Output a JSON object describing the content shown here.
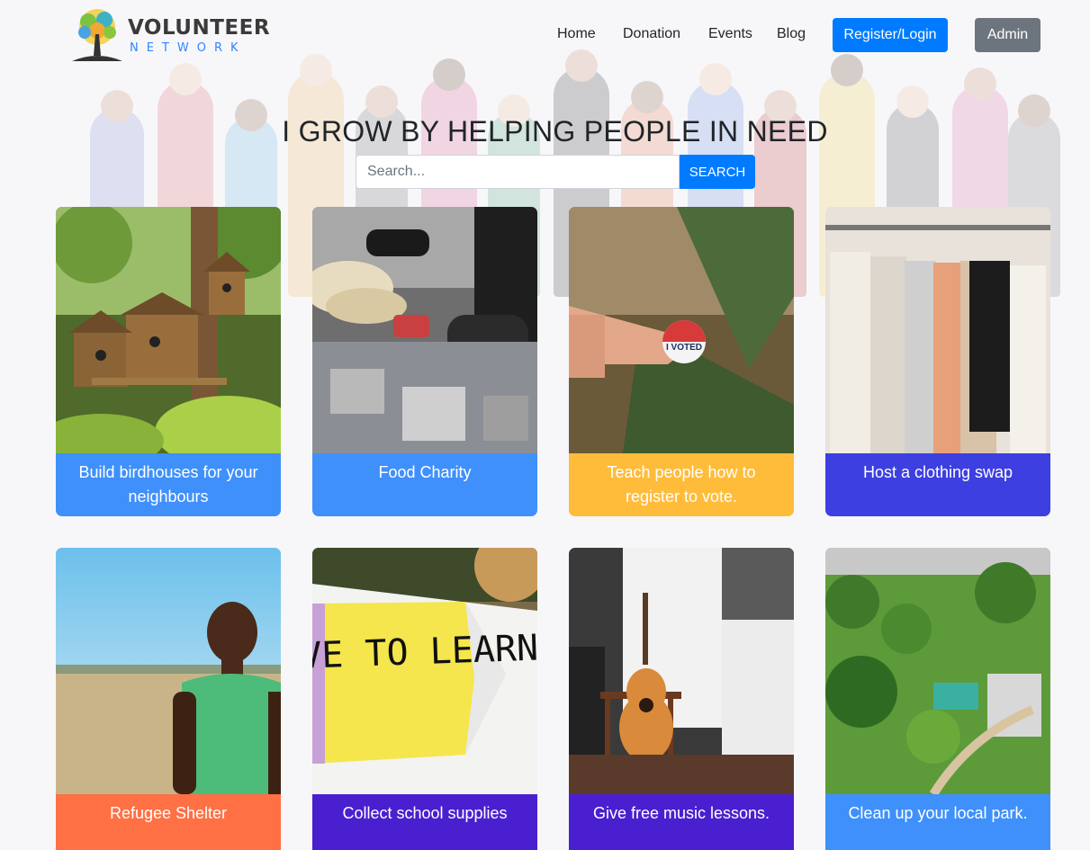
{
  "brand": {
    "title": "VOLUNTEER",
    "subtitle": "NETWORK"
  },
  "nav": {
    "items": [
      "Home",
      "Donation",
      "Events",
      "Blog"
    ],
    "register_label": "Register/Login",
    "admin_label": "Admin"
  },
  "hero": {
    "title": "I GROW BY HELPING PEOPLE IN NEED"
  },
  "search": {
    "placeholder": "Search...",
    "button_label": "SEARCH"
  },
  "colors": {
    "primary": "#007bff",
    "secondary": "#6c757d",
    "blue": "#3f90fb",
    "yellow": "#ffbc3a",
    "indigo": "#3d3fe0",
    "orange": "#ff7044",
    "purple": "#4a1fcf"
  },
  "events": [
    {
      "title": "Build birdhouses for your neighbours",
      "image": "birdhouses-photo",
      "color": "#3f90fb"
    },
    {
      "title": "Food Charity",
      "image": "food-charity-photo",
      "color": "#3f90fb"
    },
    {
      "title": "Teach people how to register to vote.",
      "image": "i-voted-sticker-photo",
      "color": "#ffbc3a"
    },
    {
      "title": "Host a clothing swap",
      "image": "clothing-rack-photo",
      "color": "#3d3fe0"
    },
    {
      "title": "Refugee Shelter",
      "image": "refugee-child-photo",
      "color": "#ff7044"
    },
    {
      "title": "Collect school supplies",
      "image": "love-to-learn-sign-photo",
      "color": "#4a1fcf"
    },
    {
      "title": "Give free music lessons.",
      "image": "guitar-room-photo",
      "color": "#4a1fcf"
    },
    {
      "title": "Clean up your local park.",
      "image": "city-park-photo",
      "color": "#3f90fb"
    }
  ],
  "sticker_text": "I VOTED",
  "sign_text": "LOVE TO LEARN"
}
